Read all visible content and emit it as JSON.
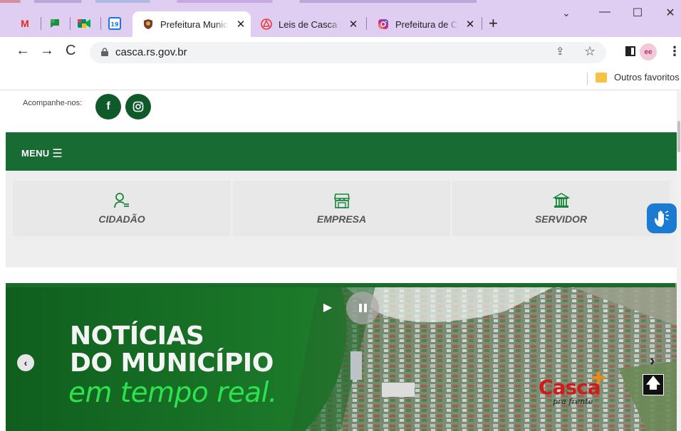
{
  "browser": {
    "pinned_tabs": [
      {
        "icon": "gmail-icon",
        "glyph": "M",
        "color": "#d93025"
      },
      {
        "icon": "google-chat-icon",
        "glyph": "■",
        "color": "#1e8e3e"
      },
      {
        "icon": "google-meet-icon",
        "glyph": "▶",
        "color": "#00897b"
      },
      {
        "icon": "google-calendar-icon",
        "glyph": "19",
        "color": "#1a73e8"
      }
    ],
    "tabs": [
      {
        "title": "Prefeitura Municipal de Casca",
        "active": true
      },
      {
        "title": "Leis de Casca RS",
        "active": false
      },
      {
        "title": "Prefeitura de Casca",
        "active": false
      }
    ],
    "new_tab": "+",
    "url": "casca.rs.gov.br",
    "bookmark_folder": "Outros favoritos"
  },
  "site": {
    "follow_label": "Acompanhe-nos:",
    "social": [
      {
        "icon": "facebook-icon",
        "glyph": "f"
      },
      {
        "icon": "instagram-icon",
        "glyph": "◎"
      }
    ],
    "menu_label": "MENU",
    "services": [
      {
        "label": "CIDADÃO",
        "icon": "citizen-icon"
      },
      {
        "label": "EMPRESA",
        "icon": "store-icon"
      },
      {
        "label": "SERVIDOR",
        "icon": "government-building-icon"
      }
    ],
    "hero": {
      "line1": "NOTÍCIAS",
      "line2": "DO MUNICÍPIO",
      "line3": "em tempo real.",
      "logo_text": "Casca",
      "logo_tagline": "pra frente"
    }
  },
  "colors": {
    "green_bar": "#176b33",
    "accent_green": "#2ee24e",
    "accessibility_blue": "#1a7bd1",
    "tabstrip": "#dfcdf2"
  }
}
